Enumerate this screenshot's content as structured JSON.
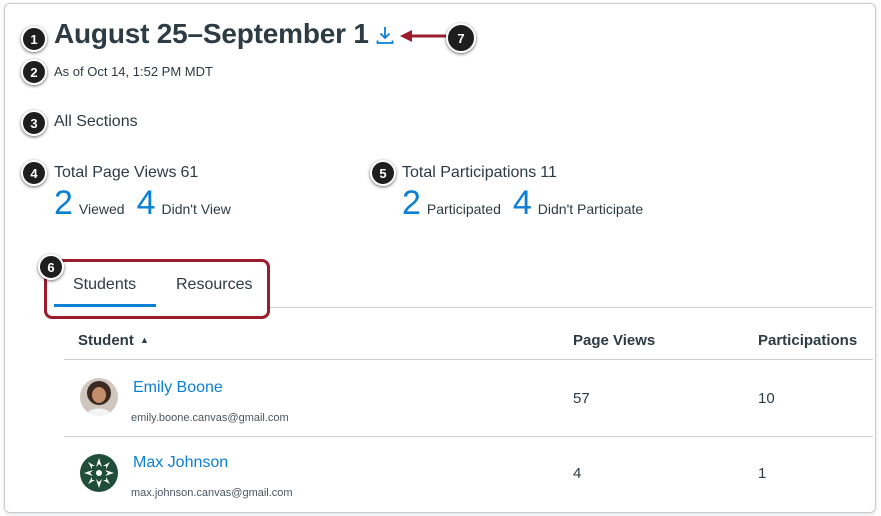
{
  "header": {
    "title": "August 25–September 1",
    "as_of": "As of Oct 14, 1:52 PM MDT",
    "section_filter": "All Sections"
  },
  "stats": {
    "page_views": {
      "heading": "Total Page Views",
      "total": "61",
      "primary_count": "2",
      "primary_label": "Viewed",
      "secondary_count": "4",
      "secondary_label": "Didn't View"
    },
    "participations": {
      "heading": "Total Participations",
      "total": "11",
      "primary_count": "2",
      "primary_label": "Participated",
      "secondary_count": "4",
      "secondary_label": "Didn't Participate"
    }
  },
  "tabs": [
    {
      "label": "Students",
      "selected": true
    },
    {
      "label": "Resources",
      "selected": false
    }
  ],
  "table": {
    "headers": {
      "student": "Student",
      "sort_indicator": "▲",
      "page_views": "Page Views",
      "participations": "Participations"
    },
    "rows": [
      {
        "name": "Emily Boone",
        "email": "emily.boone.canvas@gmail.com",
        "page_views": "57",
        "participations": "10"
      },
      {
        "name": "Max Johnson",
        "email": "max.johnson.canvas@gmail.com",
        "page_views": "4",
        "participations": "1"
      }
    ]
  },
  "callouts": [
    "1",
    "2",
    "3",
    "4",
    "5",
    "6",
    "7"
  ],
  "colors": {
    "accent": "#0b7fd3",
    "callout_arrow": "#9b1c2b",
    "text": "#2d3b45"
  },
  "icons": {
    "download": "download-icon",
    "sort": "sort-ascending-icon"
  }
}
